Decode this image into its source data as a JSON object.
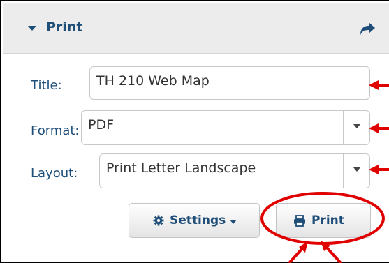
{
  "panel": {
    "title": "Print",
    "collapse_icon": "caret-down-icon",
    "popout_icon": "share-arrow-icon"
  },
  "form": {
    "title_label": "Title:",
    "title_value": "TH 210 Web Map",
    "format_label": "Format:",
    "format_value": "PDF",
    "layout_label": "Layout:",
    "layout_value": "Print Letter Landscape"
  },
  "buttons": {
    "settings_label": "Settings",
    "settings_icon": "gear-icon",
    "print_label": "Print",
    "print_icon": "printer-icon"
  },
  "colors": {
    "accent": "#1f4e79",
    "annotation": "#e00000"
  }
}
